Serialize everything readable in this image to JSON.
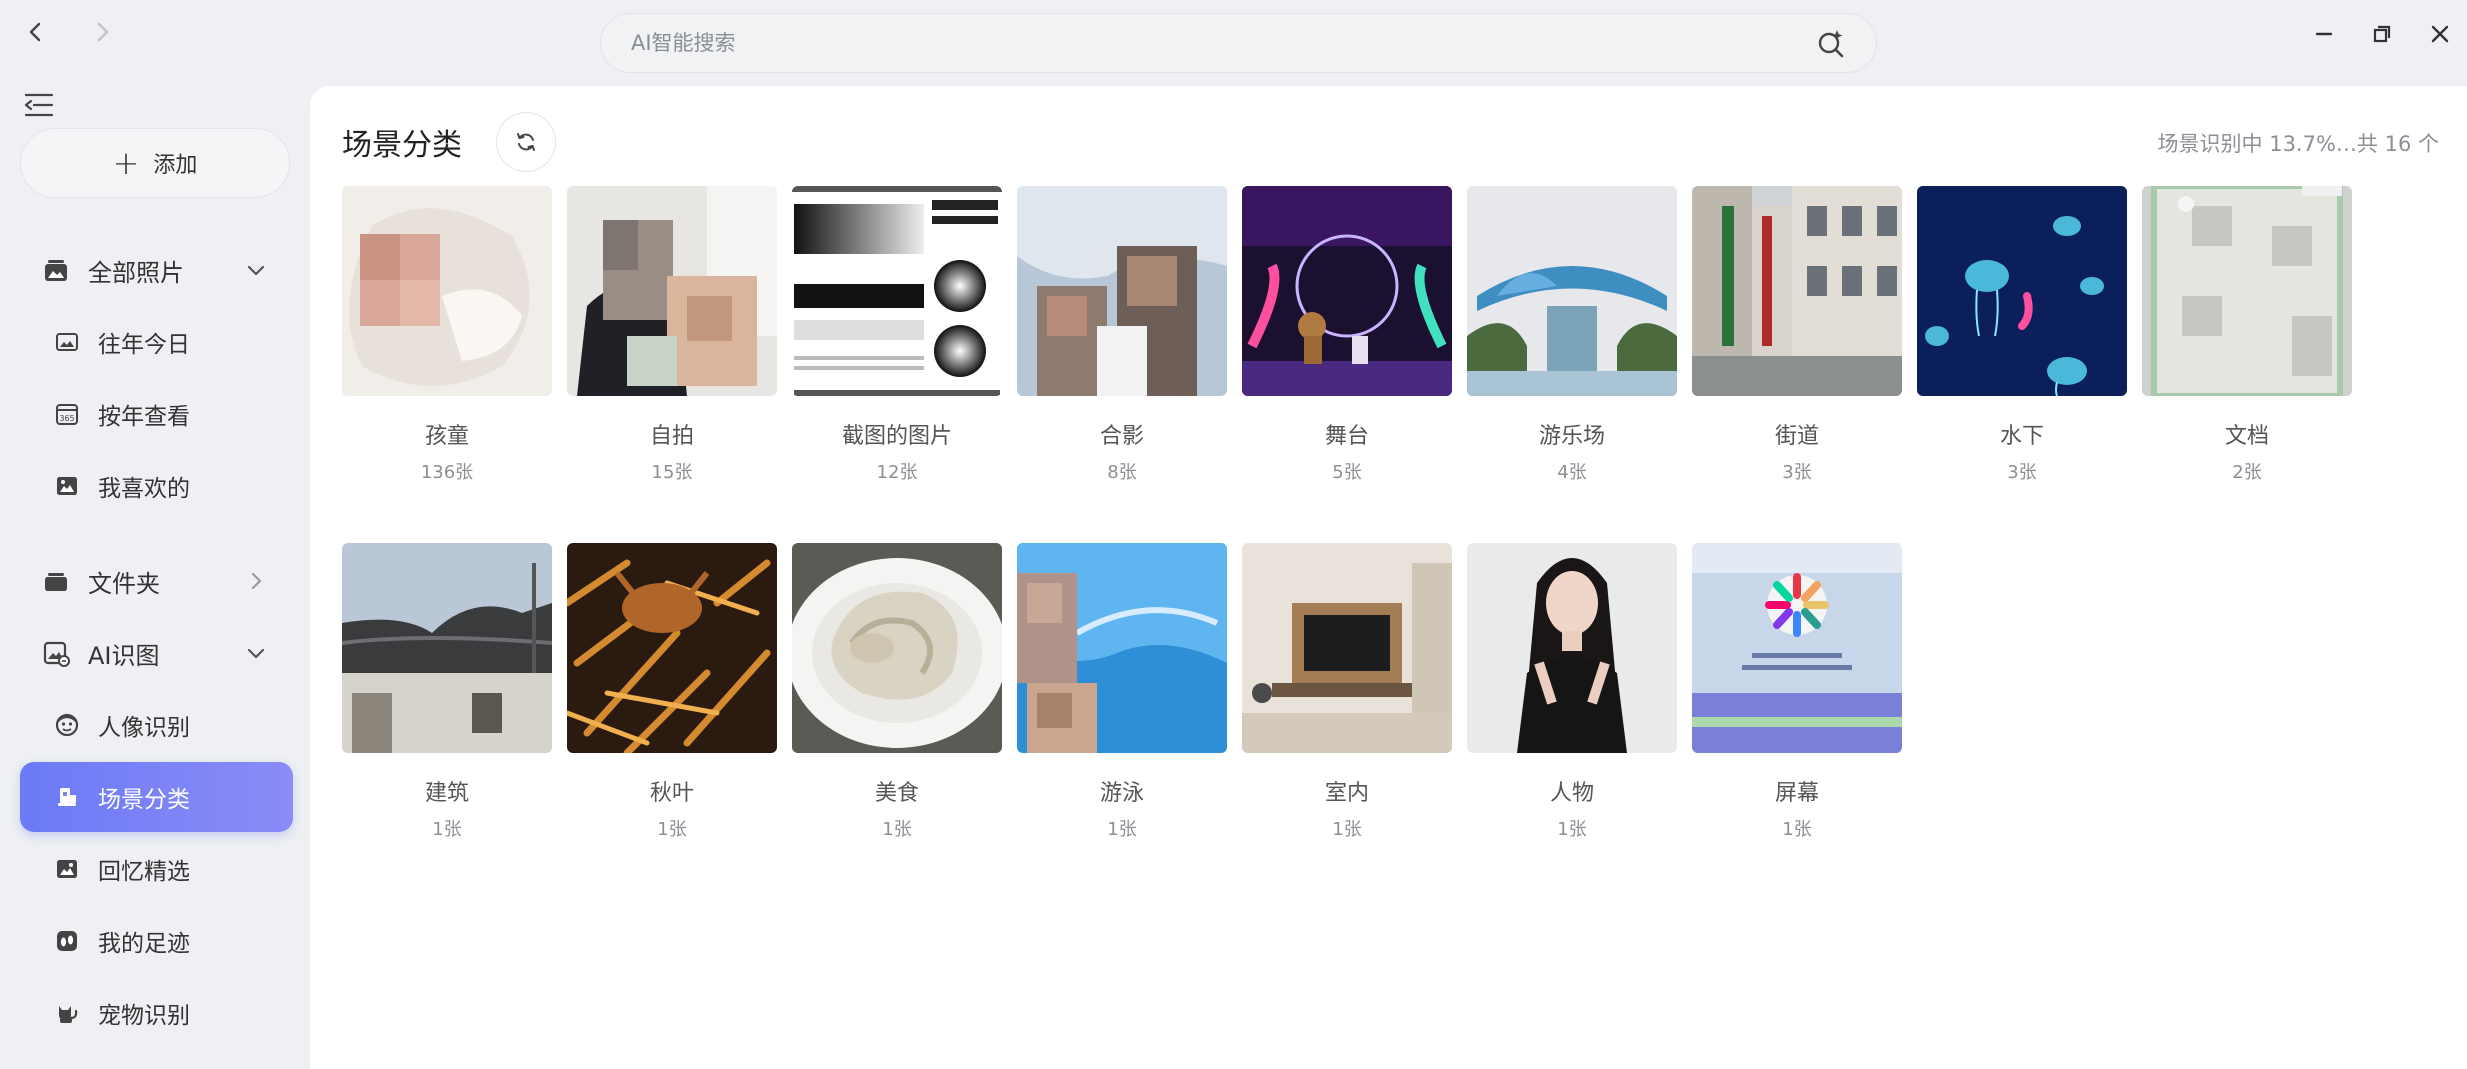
{
  "search": {
    "placeholder": "AI智能搜索"
  },
  "icons": {
    "back": "chevron-left-icon",
    "forward": "chevron-right-icon",
    "ai_search": "ai-sparkle-search-icon",
    "minimize": "minimize-icon",
    "maximize": "maximize-icon",
    "close": "close-icon"
  },
  "sidebar": {
    "add_label": "添加",
    "all_photos": "全部照片",
    "this_day": "往年今日",
    "by_year": "按年查看",
    "favorites": "我喜欢的",
    "folders": "文件夹",
    "ai_recognition": "AI识图",
    "face": "人像识别",
    "scene": "场景分类",
    "memories": "回忆精选",
    "footprints": "我的足迹",
    "pets": "宠物识别",
    "accent": "#7181f5"
  },
  "main": {
    "title": "场景分类",
    "status": "场景识别中 13.7%…共 16 个",
    "categories": [
      {
        "name": "孩童",
        "count": "136张"
      },
      {
        "name": "自拍",
        "count": "15张"
      },
      {
        "name": "截图的图片",
        "count": "12张"
      },
      {
        "name": "合影",
        "count": "8张"
      },
      {
        "name": "舞台",
        "count": "5张"
      },
      {
        "name": "游乐场",
        "count": "4张"
      },
      {
        "name": "街道",
        "count": "3张"
      },
      {
        "name": "水下",
        "count": "3张"
      },
      {
        "name": "文档",
        "count": "2张"
      },
      {
        "name": "建筑",
        "count": "1张"
      },
      {
        "name": "秋叶",
        "count": "1张"
      },
      {
        "name": "美食",
        "count": "1张"
      },
      {
        "name": "游泳",
        "count": "1张"
      },
      {
        "name": "室内",
        "count": "1张"
      },
      {
        "name": "人物",
        "count": "1张"
      },
      {
        "name": "屏幕",
        "count": "1张"
      }
    ]
  }
}
